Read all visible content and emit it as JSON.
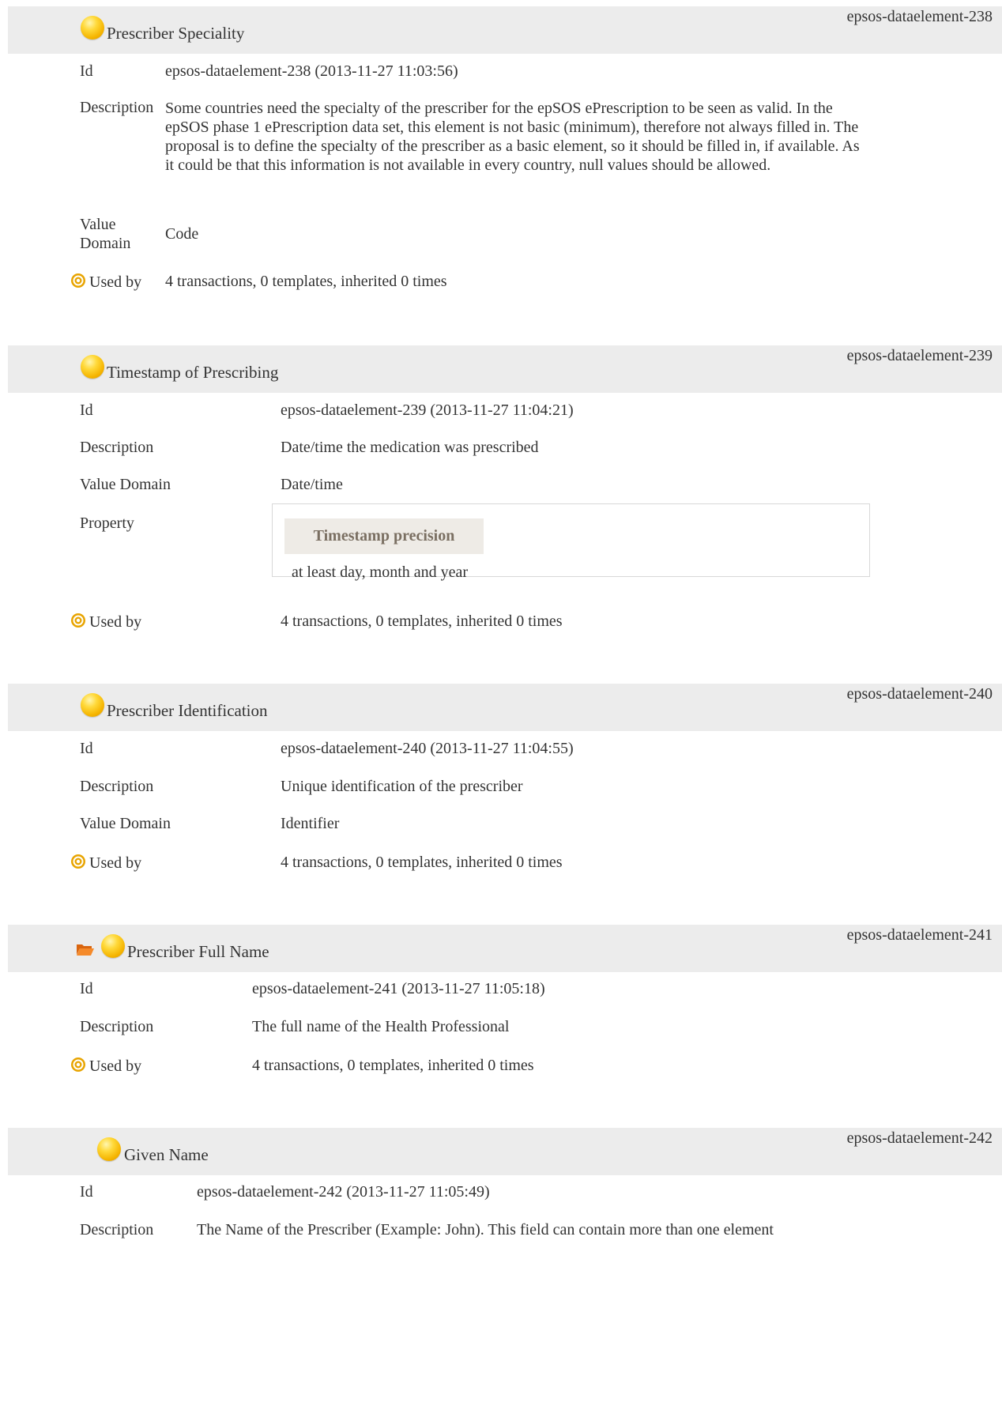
{
  "sections": [
    {
      "title": "Prescriber Speciality",
      "tag_id": "epsos-dataelement-238",
      "id_label": "Id",
      "id_value": "epsos-dataelement-238 (2013-11-27 11:03:56)",
      "desc_label": "Description",
      "desc_value": "Some countries need the specialty of the prescriber for the epSOS ePrescription to be seen as valid. In the epSOS phase 1 ePrescription data set, this element is not basic (minimum), therefore not always filled in. The proposal is to define the specialty of the prescriber as a basic element, so it should be filled in, if available. As it could be that this information is not available in every country, null values should be allowed.",
      "vd_label_line1": "Value",
      "vd_label_line2": "Domain",
      "vd_value": "Code",
      "used_label": "Used by",
      "used_value": "4 transactions, 0 templates, inherited 0 times"
    },
    {
      "title": "Timestamp of Prescribing",
      "tag_id": "epsos-dataelement-239",
      "id_label": "Id",
      "id_value": "epsos-dataelement-239 (2013-11-27 11:04:21)",
      "desc_label": "Description",
      "desc_value": "Date/time the medication was prescribed",
      "vd_label": "Value Domain",
      "vd_value": "Date/time",
      "prop_label": "Property",
      "prop_name": "Timestamp precision",
      "prop_value": "at least day, month and year",
      "used_label": "Used by",
      "used_value": "4 transactions, 0 templates, inherited 0 times"
    },
    {
      "title": "Prescriber Identification",
      "tag_id": "epsos-dataelement-240",
      "id_label": "Id",
      "id_value": "epsos-dataelement-240 (2013-11-27 11:04:55)",
      "desc_label": "Description",
      "desc_value": "Unique identification of the prescriber",
      "vd_label": "Value Domain",
      "vd_value": "Identifier",
      "used_label": "Used by",
      "used_value": "4 transactions, 0 templates, inherited 0 times"
    },
    {
      "title": "Prescriber Full Name",
      "tag_id": "epsos-dataelement-241",
      "id_label": "Id",
      "id_value": "epsos-dataelement-241 (2013-11-27 11:05:18)",
      "desc_label": "Description",
      "desc_value": "The full name of the Health Professional",
      "used_label": "Used by",
      "used_value": "4 transactions, 0 templates, inherited 0 times"
    },
    {
      "title": "Given Name",
      "tag_id": "epsos-dataelement-242",
      "id_label": "Id",
      "id_value": "epsos-dataelement-242 (2013-11-27 11:05:49)",
      "desc_label": "Description",
      "desc_value": "The Name of the Prescriber (Example: John). This field can contain more than one element"
    }
  ],
  "icons": {
    "concept": "yellow-ball-icon",
    "group": "open-folder-icon",
    "used_by": "target-icon"
  },
  "colors": {
    "header_bg": "#ececec",
    "property_tag_bg": "#eeebe6",
    "property_tag_text": "#7a6f62",
    "ball": "#f5b400",
    "target": "#e8a400",
    "folder": "#f07a1e"
  }
}
